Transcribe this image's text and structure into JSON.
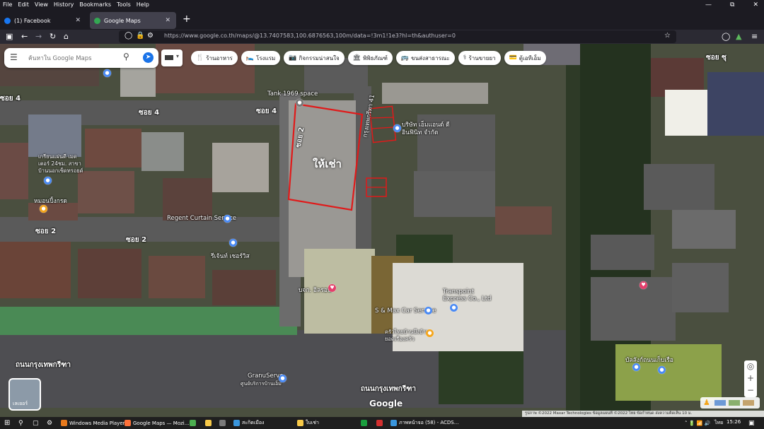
{
  "menubar": {
    "items": [
      "File",
      "Edit",
      "View",
      "History",
      "Bookmarks",
      "Tools",
      "Help"
    ]
  },
  "tabs": [
    {
      "title": "(1) Facebook",
      "favicon_color": "#1877f2"
    },
    {
      "title": "Google Maps",
      "favicon_color": "#34a853"
    }
  ],
  "nav": {
    "url": "https://www.google.co.th/maps/@13.7407583,100.6876563,100m/data=!3m1!1e3?hl=th&authuser=0"
  },
  "search": {
    "placeholder": "ค้นหาใน Google Maps"
  },
  "chips": [
    {
      "label": "ร้านอาหาร",
      "icon": "fork-knife-icon"
    },
    {
      "label": "โรงแรม",
      "icon": "bed-icon"
    },
    {
      "label": "กิจกรรมน่าสนใจ",
      "icon": "camera-icon"
    },
    {
      "label": "พิพิธภัณฑ์",
      "icon": "museum-icon"
    },
    {
      "label": "ขนส่งสาธารณะ",
      "icon": "bus-icon"
    },
    {
      "label": "ร้านขายยา",
      "icon": "pharmacy-icon"
    },
    {
      "label": "ตู้เอทีเอ็ม",
      "icon": "atm-icon"
    }
  ],
  "map_labels": {
    "soi4_top_right": "ซอย 4",
    "soi4_left": "ซอย 4",
    "soi4_center": "ซอย 4",
    "tank": "Tank 1969 space",
    "soi2_vertical": "ซอย 2",
    "soi41": "กรุงเทพกรีทา 41",
    "for_rent": "ให้เช่า",
    "company": "บริษัท เอ็มแอนด์ ดี อินฟินิท จำกัด",
    "left_building": "เกรียนแผ่นดี เมดเตอร์ 24ชม. สาขา บ้านนอกเซ็ดทรอยด์",
    "homestay": "หมอนปิ้งกรด",
    "soi2_left": "ซอย 2",
    "soi2_mid": "ซอย 2",
    "regent": "Regent Curtain Service",
    "regent2": "รีเจ้นท์ เซอร์วิส",
    "shop": "บจก. อิลรอน",
    "transpoint": "Transpoint Express Co., Ltd",
    "smax": "S & Max Car Service",
    "kitchen": "ครัวไทยบ้านบึงบ้าน ยอดเรื่องครัว",
    "road_left": "ถนนกรุงเทพกรีฑา",
    "road_right": "ถนนกรุงเทพกรีฑา",
    "granuserve": "GranuServe",
    "granuserve2": "ศูนย์บริการบ้านเอ็ม",
    "right_bottom": "บัลลังก์ถนนเก็บเรือ",
    "soi_top_right2": "ซอย ซุ"
  },
  "map": {
    "layer_label": "เลเยอร์",
    "google": "Google",
    "attribution": "รูปภาพ ©2022 Maxar Technologies ข้อมูลแผนที่ ©2022   ไทย   ข้อกำหนด   ส่งความคิดเห็น   10 ม."
  },
  "taskbar": {
    "items": [
      {
        "label": "Windows Media Player",
        "color": "#e87a1d"
      },
      {
        "label": "Google Maps — Mozi...",
        "color": "#ff7139"
      },
      {
        "label": "",
        "color": "#4caf50"
      },
      {
        "label": "",
        "color": "#f7c948"
      },
      {
        "label": "",
        "color": "#7a7a7a"
      },
      {
        "label": "",
        "color": "#3a96dd"
      },
      {
        "label": "สะกิดเมือง",
        "color": "#f7c948"
      },
      {
        "label": "ใบเช่า",
        "color": "#f7c948"
      },
      {
        "label": "",
        "color": "#1b9e3e"
      },
      {
        "label": "",
        "color": "#d32f2f"
      },
      {
        "label": "",
        "color": "#3a96dd"
      },
      {
        "label": "ภาพหน้าจอ (58) - ACDS...",
        "color": "#3a96dd"
      }
    ],
    "lang": "ไทย",
    "time": "15:26"
  }
}
